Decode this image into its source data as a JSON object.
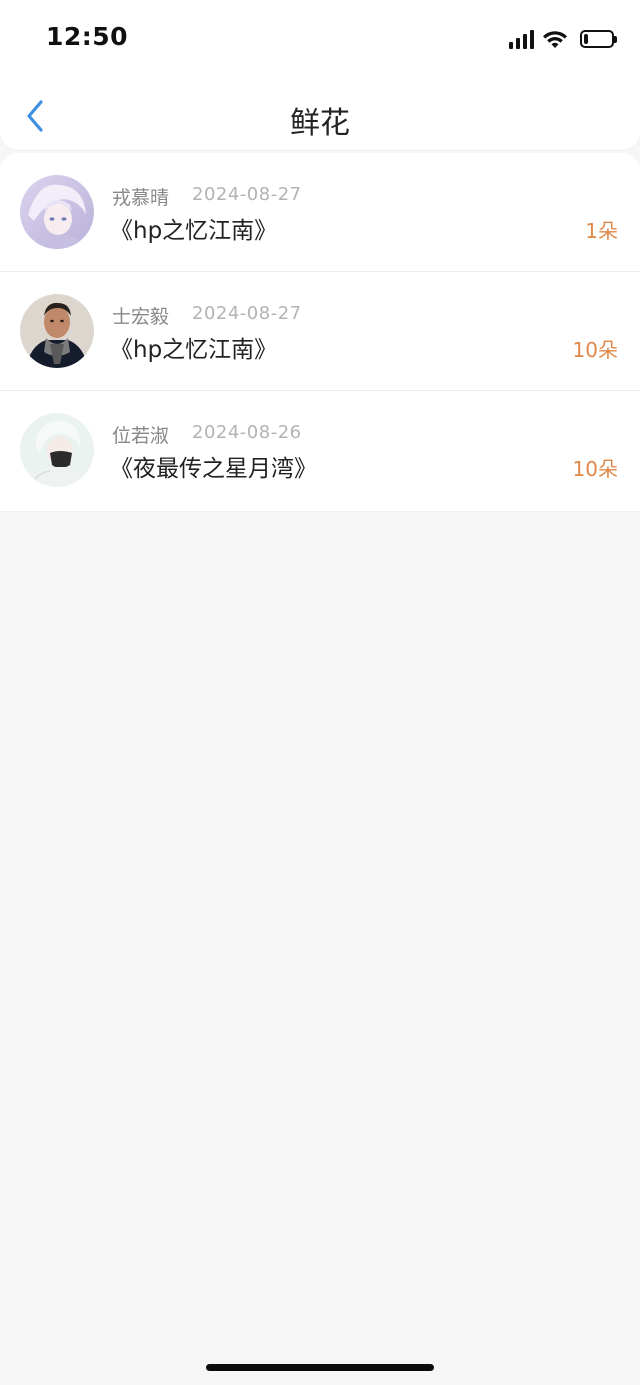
{
  "status_bar": {
    "time": "12:50",
    "icons": [
      "cellular-signal-icon",
      "wifi-icon",
      "battery-icon"
    ],
    "battery_level": 0.15
  },
  "header": {
    "back_icon": "chevron-left-icon",
    "title": "鲜花"
  },
  "colors": {
    "accent": "#3d8fe0",
    "count": "#e0884a",
    "name": "#888888",
    "date": "#b3b3b3"
  },
  "items": [
    {
      "name": "戎慕晴",
      "date": "2024-08-27",
      "book": "《hp之忆江南》",
      "count": "1朵"
    },
    {
      "name": "士宏毅",
      "date": "2024-08-27",
      "book": "《hp之忆江南》",
      "count": "10朵"
    },
    {
      "name": "位若淑",
      "date": "2024-08-26",
      "book": "《夜最传之星月湾》",
      "count": "10朵"
    }
  ]
}
